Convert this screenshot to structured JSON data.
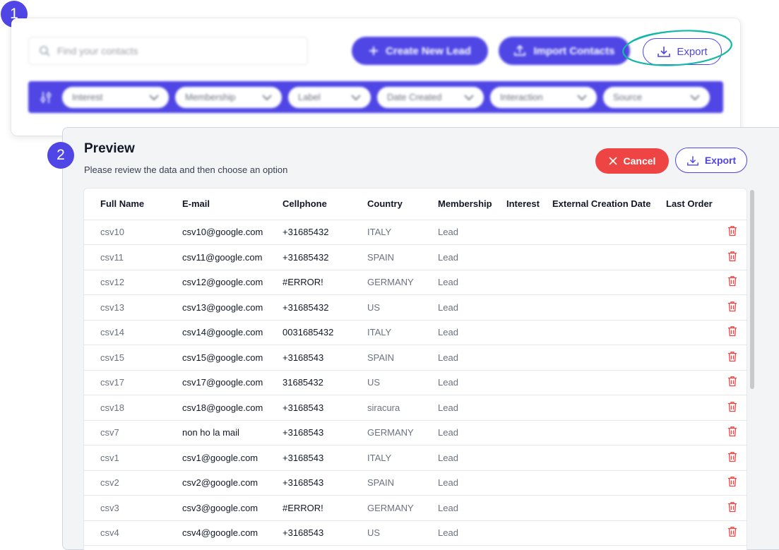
{
  "steps": {
    "one": "1",
    "two": "2"
  },
  "toolbar": {
    "search_placeholder": "Find your contacts",
    "create_lead_label": "Create New Lead",
    "import_contacts_label": "Import Contacts",
    "export_label": "Export",
    "filters": [
      "Interest",
      "Membership",
      "Label",
      "Date Created",
      "Interaction",
      "Source"
    ]
  },
  "preview": {
    "title": "Preview",
    "subtitle": "Please review the data and then choose an option",
    "cancel_label": "Cancel",
    "export_label": "Export",
    "columns": [
      "Full Name",
      "E-mail",
      "Cellphone",
      "Country",
      "Membership",
      "Interest",
      "External Creation Date",
      "Last Order"
    ],
    "rows": [
      {
        "name": "csv10",
        "email": "csv10@google.com",
        "phone": "+31685432",
        "country": "ITALY",
        "membership": "Lead"
      },
      {
        "name": "csv11",
        "email": "csv11@google.com",
        "phone": "+31685432",
        "country": "SPAIN",
        "membership": "Lead"
      },
      {
        "name": "csv12",
        "email": "csv12@google.com",
        "phone": "#ERROR!",
        "country": "GERMANY",
        "membership": "Lead"
      },
      {
        "name": "csv13",
        "email": "csv13@google.com",
        "phone": "+31685432",
        "country": "US",
        "membership": "Lead"
      },
      {
        "name": "csv14",
        "email": "csv14@google.com",
        "phone": "0031685432",
        "country": "ITALY",
        "membership": "Lead"
      },
      {
        "name": "csv15",
        "email": "csv15@google.com",
        "phone": "+3168543",
        "country": "SPAIN",
        "membership": "Lead"
      },
      {
        "name": "csv17",
        "email": "csv17@google.com",
        "phone": "31685432",
        "country": "US",
        "membership": "Lead"
      },
      {
        "name": "csv18",
        "email": "csv18@google.com",
        "phone": "+3168543",
        "country": "siracura",
        "membership": "Lead"
      },
      {
        "name": "csv7",
        "email": "non ho la mail",
        "phone": "+3168543",
        "country": "GERMANY",
        "membership": "Lead"
      },
      {
        "name": "csv1",
        "email": "csv1@google.com",
        "phone": "+3168543",
        "country": "ITALY",
        "membership": "Lead"
      },
      {
        "name": "csv2",
        "email": "csv2@google.com",
        "phone": "+3168543",
        "country": "SPAIN",
        "membership": "Lead"
      },
      {
        "name": "csv3",
        "email": "csv3@google.com",
        "phone": "#ERROR!",
        "country": "GERMANY",
        "membership": "Lead"
      },
      {
        "name": "csv4",
        "email": "csv4@google.com",
        "phone": "+3168543",
        "country": "US",
        "membership": "Lead"
      }
    ]
  },
  "colors": {
    "primary": "#4f46e5",
    "danger": "#ef4444",
    "highlight": "#14b8a6"
  },
  "icons": {
    "search": "search-icon",
    "plus": "plus-icon",
    "upload": "upload-icon",
    "download": "download-icon",
    "sliders": "sliders-icon",
    "chevron": "chevron-down-icon",
    "close": "close-icon",
    "trash": "trash-icon"
  }
}
